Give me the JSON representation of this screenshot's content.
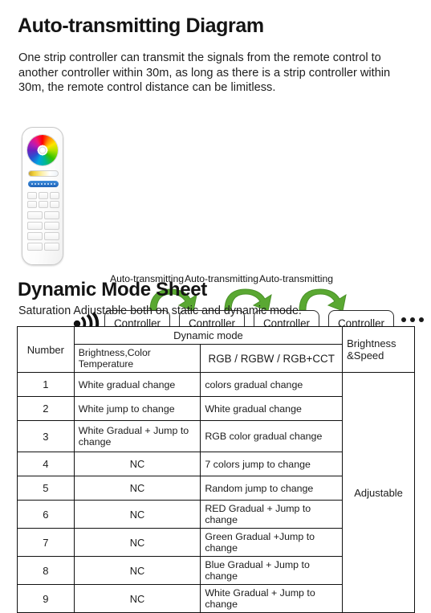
{
  "section1": {
    "heading": "Auto-transmitting Diagram",
    "body": "One strip controller can transmit the signals from the remote control to another controller within 30m, as long as there is a strip controller within 30m, the remote control distance can be limitless."
  },
  "diagram": {
    "rf_icon": "rf-signal-icon",
    "arrow_icon": "curved-arrow-right-icon",
    "transmit_labels": [
      "Auto-transmitting",
      "Auto-transmitting",
      "Auto-transmitting"
    ],
    "controllers": [
      "Controller",
      "Controller",
      "Controller",
      "Controller"
    ],
    "continuation": "...",
    "arrow_color": "#5aa832",
    "remote": {
      "name": "rf-remote-control",
      "color_wheel": "color-wheel-icon",
      "cct_slider": "color-temperature-slider",
      "brightness_bar": "brightness-indicator-bar"
    }
  },
  "section2": {
    "heading": "Dynamic Mode Sheet",
    "subtitle": "Saturation Adjustable both on static and dynamic mode."
  },
  "table": {
    "headers": {
      "number": "Number",
      "dynamic_mode": "Dynamic mode",
      "sub_bct": "Brightness,Color Temperature",
      "sub_rgb": "RGB / RGBW / RGB+CCT",
      "brightness_speed": "Brightness &Speed"
    },
    "brightness_speed_value": "Adjustable",
    "rows": [
      {
        "number": "1",
        "bct": "White gradual change",
        "rgb": "colors gradual change"
      },
      {
        "number": "2",
        "bct": "White jump to change",
        "rgb": "White gradual change"
      },
      {
        "number": "3",
        "bct": "White Gradual + Jump to change",
        "rgb": "RGB color gradual change"
      },
      {
        "number": "4",
        "bct": "NC",
        "rgb": "7 colors jump to change"
      },
      {
        "number": "5",
        "bct": "NC",
        "rgb": "Random jump to change"
      },
      {
        "number": "6",
        "bct": "NC",
        "rgb": "RED Gradual + Jump to change"
      },
      {
        "number": "7",
        "bct": "NC",
        "rgb": "Green Gradual +Jump to change"
      },
      {
        "number": "8",
        "bct": "NC",
        "rgb": "Blue Gradual + Jump to change"
      },
      {
        "number": "9",
        "bct": "NC",
        "rgb": "White Gradual + Jump to change"
      }
    ]
  }
}
